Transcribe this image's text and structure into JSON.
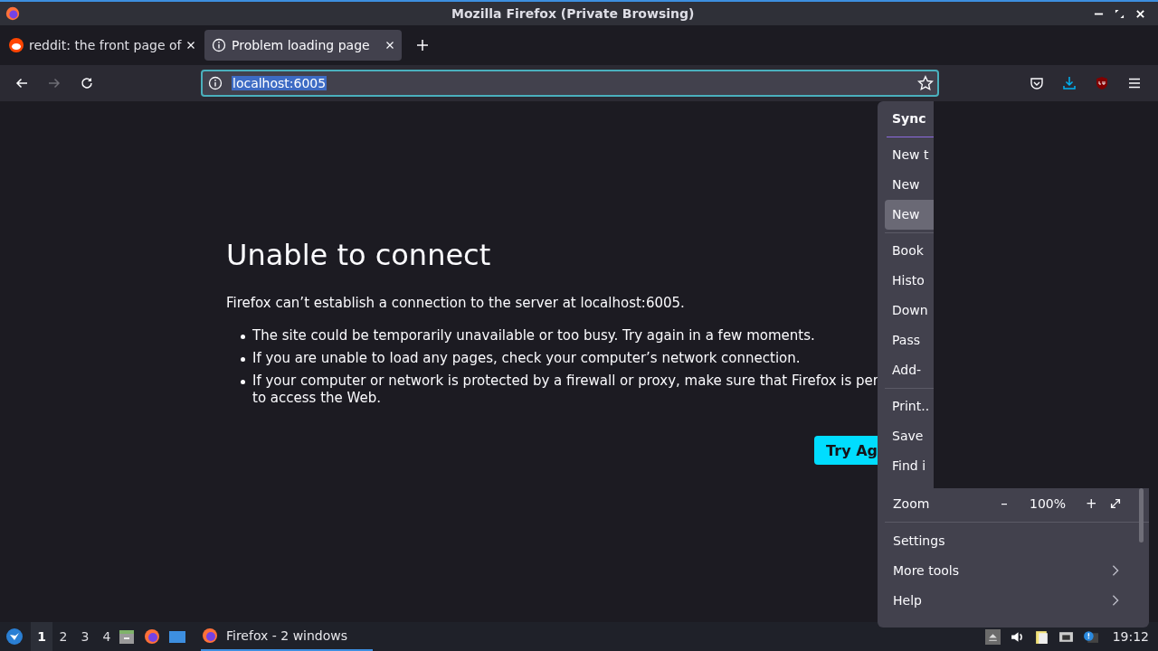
{
  "window": {
    "title": "Mozilla Firefox (Private Browsing)"
  },
  "tabs": [
    {
      "label": "reddit: the front page of",
      "selected": false
    },
    {
      "label": "Problem loading page",
      "selected": true
    }
  ],
  "address_bar": {
    "value": "localhost:6005"
  },
  "page": {
    "heading": "Unable to connect",
    "message": "Firefox can’t establish a connection to the server at localhost:6005.",
    "bullets": [
      {
        "lines": [
          "The site could be temporarily unavailable or too busy. Try again in a few moments."
        ]
      },
      {
        "lines": [
          "If you are unable to load any pages, check your computer’s network connection."
        ]
      },
      {
        "lines": [
          "If your computer or network is protected by a firewall or proxy, make sure that Firefox is per",
          "to access the Web."
        ]
      }
    ],
    "button": "Try Ag"
  },
  "menu": {
    "top_items": [
      {
        "kind": "header",
        "label": "Sync",
        "selected": false
      },
      {
        "kind": "separator"
      },
      {
        "kind": "item",
        "label": "New t",
        "selected": false
      },
      {
        "kind": "item",
        "label": "New",
        "selected": false
      },
      {
        "kind": "item",
        "label": "New",
        "selected": true
      },
      {
        "kind": "separator"
      },
      {
        "kind": "item",
        "label": "Book",
        "selected": false
      },
      {
        "kind": "item",
        "label": "Histo",
        "selected": false
      },
      {
        "kind": "item",
        "label": "Down",
        "selected": false
      },
      {
        "kind": "item",
        "label": "Pass",
        "selected": false
      },
      {
        "kind": "item",
        "label": "Add-",
        "selected": false
      },
      {
        "kind": "separator"
      },
      {
        "kind": "item",
        "label": "Print..",
        "selected": false
      },
      {
        "kind": "item",
        "label": "Save",
        "selected": false
      },
      {
        "kind": "item",
        "label": "Find i",
        "selected": false
      }
    ],
    "zoom": {
      "label": "Zoom",
      "minus": "–",
      "value": "100%",
      "plus": "+"
    },
    "bottom_items": [
      {
        "label": "Settings",
        "submenu": false
      },
      {
        "label": "More tools",
        "submenu": true
      },
      {
        "label": "Help",
        "submenu": true
      }
    ]
  },
  "taskbar": {
    "workspaces": [
      {
        "label": "1",
        "selected": true
      },
      {
        "label": "2",
        "selected": false
      },
      {
        "label": "3",
        "selected": false
      },
      {
        "label": "4",
        "selected": false
      }
    ],
    "task": "Firefox - 2 windows",
    "clock": "19:12"
  }
}
